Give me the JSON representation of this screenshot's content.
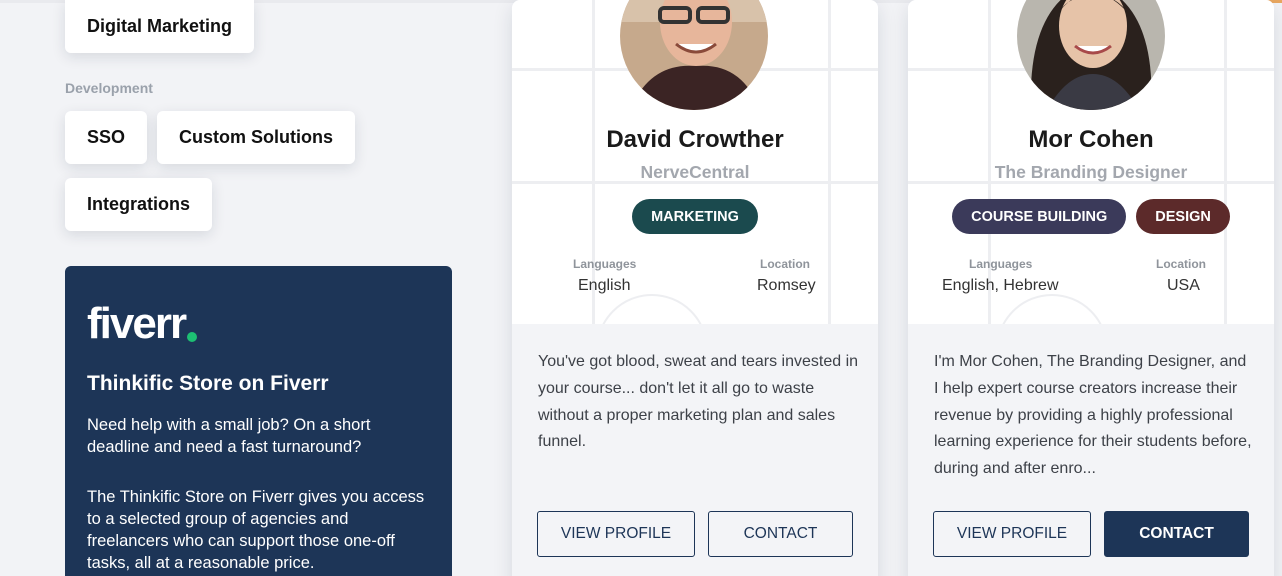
{
  "categories": {
    "marketing_tag": "Digital Marketing",
    "development_label": "Development",
    "development_tags": [
      "SSO",
      "Custom Solutions",
      "Integrations"
    ]
  },
  "fiverr": {
    "logo_text": "fiverr",
    "title": "Thinkific Store on Fiverr",
    "paragraph1": "Need help with a small job? On a short deadline and need a fast turnaround?",
    "paragraph2": "The Thinkific Store on Fiverr gives you access to a selected group of agencies and freelancers who can support those one-off tasks, all at a reasonable price.",
    "brand_color": "#1d3557",
    "dot_color": "#1dbf73"
  },
  "experts": [
    {
      "name": "David Crowther",
      "company": "NerveCentral",
      "badges": [
        {
          "label": "MARKETING",
          "color": "#1b4a4e"
        }
      ],
      "languages_label": "Languages",
      "languages": "English",
      "location_label": "Location",
      "location": "Romsey",
      "bio": "You've got blood, sweat and tears invested in your course... don't let it all go to waste without a proper marketing plan and sales funnel.",
      "view_profile": "VIEW PROFILE",
      "contact": "CONTACT"
    },
    {
      "name": "Mor Cohen",
      "company": "The Branding Designer",
      "badges": [
        {
          "label": "COURSE BUILDING",
          "color": "#3b3a5a"
        },
        {
          "label": "DESIGN",
          "color": "#5c2a2a"
        }
      ],
      "languages_label": "Languages",
      "languages": "English, Hebrew",
      "location_label": "Location",
      "location": "USA",
      "bio": "I'm Mor Cohen, The Branding Designer, and I help expert course creators increase their revenue by providing a highly professional learning experience for their students before, during and after enro...",
      "view_profile": "VIEW PROFILE",
      "contact": "CONTACT"
    }
  ]
}
